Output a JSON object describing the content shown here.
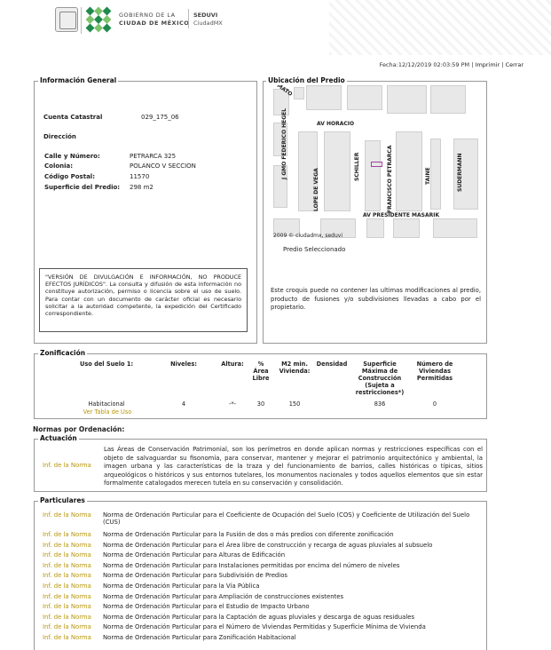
{
  "header": {
    "gob_line1": "GOBIERNO DE LA",
    "gob_line2": "CIUDAD DE MÉXICO",
    "seduvi": "SEDUVI",
    "seduvi_sub": "CiudadMX"
  },
  "toplinks": {
    "fecha": "Fecha:12/12/2019 02:03:59 PM",
    "sep1": "|",
    "imprimir": "Imprimir",
    "sep2": "|",
    "cerrar": "Cerrar"
  },
  "info": {
    "legend": "Información General",
    "cuenta_label": "Cuenta Catastral",
    "cuenta_value": "029_175_06",
    "direccion": "Dirección",
    "calle_label": "Calle y Número:",
    "calle_value": "PETRARCA 325",
    "colonia_label": "Colonia:",
    "colonia_value": "POLANCO V SECCION",
    "cp_label": "Código Postal:",
    "cp_value": "11570",
    "sup_label": "Superficie del Predio:",
    "sup_value": "298 m2",
    "disclaimer": "\"VERSIÓN DE DIVULGACIÓN E INFORMACIÓN, NO PRODUCE EFECTOS JURÍDICOS\". La consulta y difusión de esta información no constituye autorización, permiso o licencia sobre el uso de suelo. Para contar con un documento de carácter oficial es necesario solicitar a la autoridad competente, la expedición del Certificado correspondiente."
  },
  "ubicacion": {
    "legend": "Ubicación del Predio",
    "streets": {
      "s1": "AV HORACIO",
      "s2": "AV PRESIDENTE MASARIK",
      "s3": "J GMO FEDERICO HEGEL",
      "s4": "LOPE DE VEGA",
      "s5": "SCHILLER",
      "s6": "FRANCISCO PETRARCA",
      "s7": "TAINE",
      "s8": "SUDERMANN",
      "s9": "MATO"
    },
    "copyright": "2009 © ciudadmx, seduvi",
    "selected": "Predio Seleccionado",
    "note": "Este croquis puede no contener las ultimas modificaciones al predio, producto de fusiones y/o subdivisiones llevadas a cabo por el propietario.",
    "highlight_color": "#e8a0d8"
  },
  "zonificacion": {
    "legend": "Zonificación",
    "headers": {
      "uso": "Uso del Suelo 1:",
      "niveles": "Niveles:",
      "altura": "Altura:",
      "area": "% Área Libre",
      "m2": "M2 min. Vivienda:",
      "densidad": "Densidad",
      "superficie": "Superficie Máxima de Construcción (Sujeta a restricciones*)",
      "viviendas": "Número de Viviendas Permitidas"
    },
    "row": {
      "uso": "Habitacional",
      "niveles": "4",
      "altura": "-*-",
      "area": "30",
      "m2": "150",
      "superficie": "836",
      "viviendas": "0"
    },
    "ver_tabla": "Ver Tabla de Uso"
  },
  "normas": {
    "title": "Normas por Ordenación:",
    "actuacion_legend": "Actuación",
    "actuacion_link": "Inf. de la Norma",
    "actuacion_text": "Las Áreas de Conservación Patrimonial, son los perímetros en donde aplican normas y restricciones específicas con el objeto de salvaguardar su fisonomía, para conservar, mantener y mejorar el patrimonio arquitectónico y ambiental, la imagen urbana y las características de la traza y del funcionamiento de barrios, calles históricas o típicas, sitios arqueológicos o históricos y sus entornos tutelares, los monumentos nacionales y todos aquellos elementos que sin estar formalmente catalogados merecen tutela en su conservación y consolidación.",
    "particulares_legend": "Particulares",
    "link_label": "Inf. de la Norma",
    "items": [
      "Norma de Ordenación Particular para el Coeficiente de Ocupación del Suelo (COS) y Coeficiente de Utilización del Suelo (CUS)",
      "Norma de Ordenación Particular para la Fusión de dos o más predios con diferente zonificación",
      "Norma de Ordenación Particular para el Área libre de construcción y recarga de aguas pluviales al subsuelo",
      "Norma de Ordenación Particular para Alturas de Edificación",
      "Norma de Ordenación Particular para Instalaciones permitidas por encima del número de niveles",
      "Norma de Ordenación Particular para Subdivisión de Predios",
      "Norma de Ordenación Particular para la Vía Pública",
      "Norma de Ordenación Particular para Ampliación de construcciones existentes",
      "Norma de Ordenación Particular para el Estudio de Impacto Urbano",
      "Norma de Ordenación Particular para la Captación de aguas pluviales y descarga de aguas residuales",
      "Norma de Ordenación Particular para el Número de Viviendas Permitidas y Superficie Mínima de Vivienda",
      "Norma de Ordenación Particular para Zonificación Habitacional"
    ]
  }
}
